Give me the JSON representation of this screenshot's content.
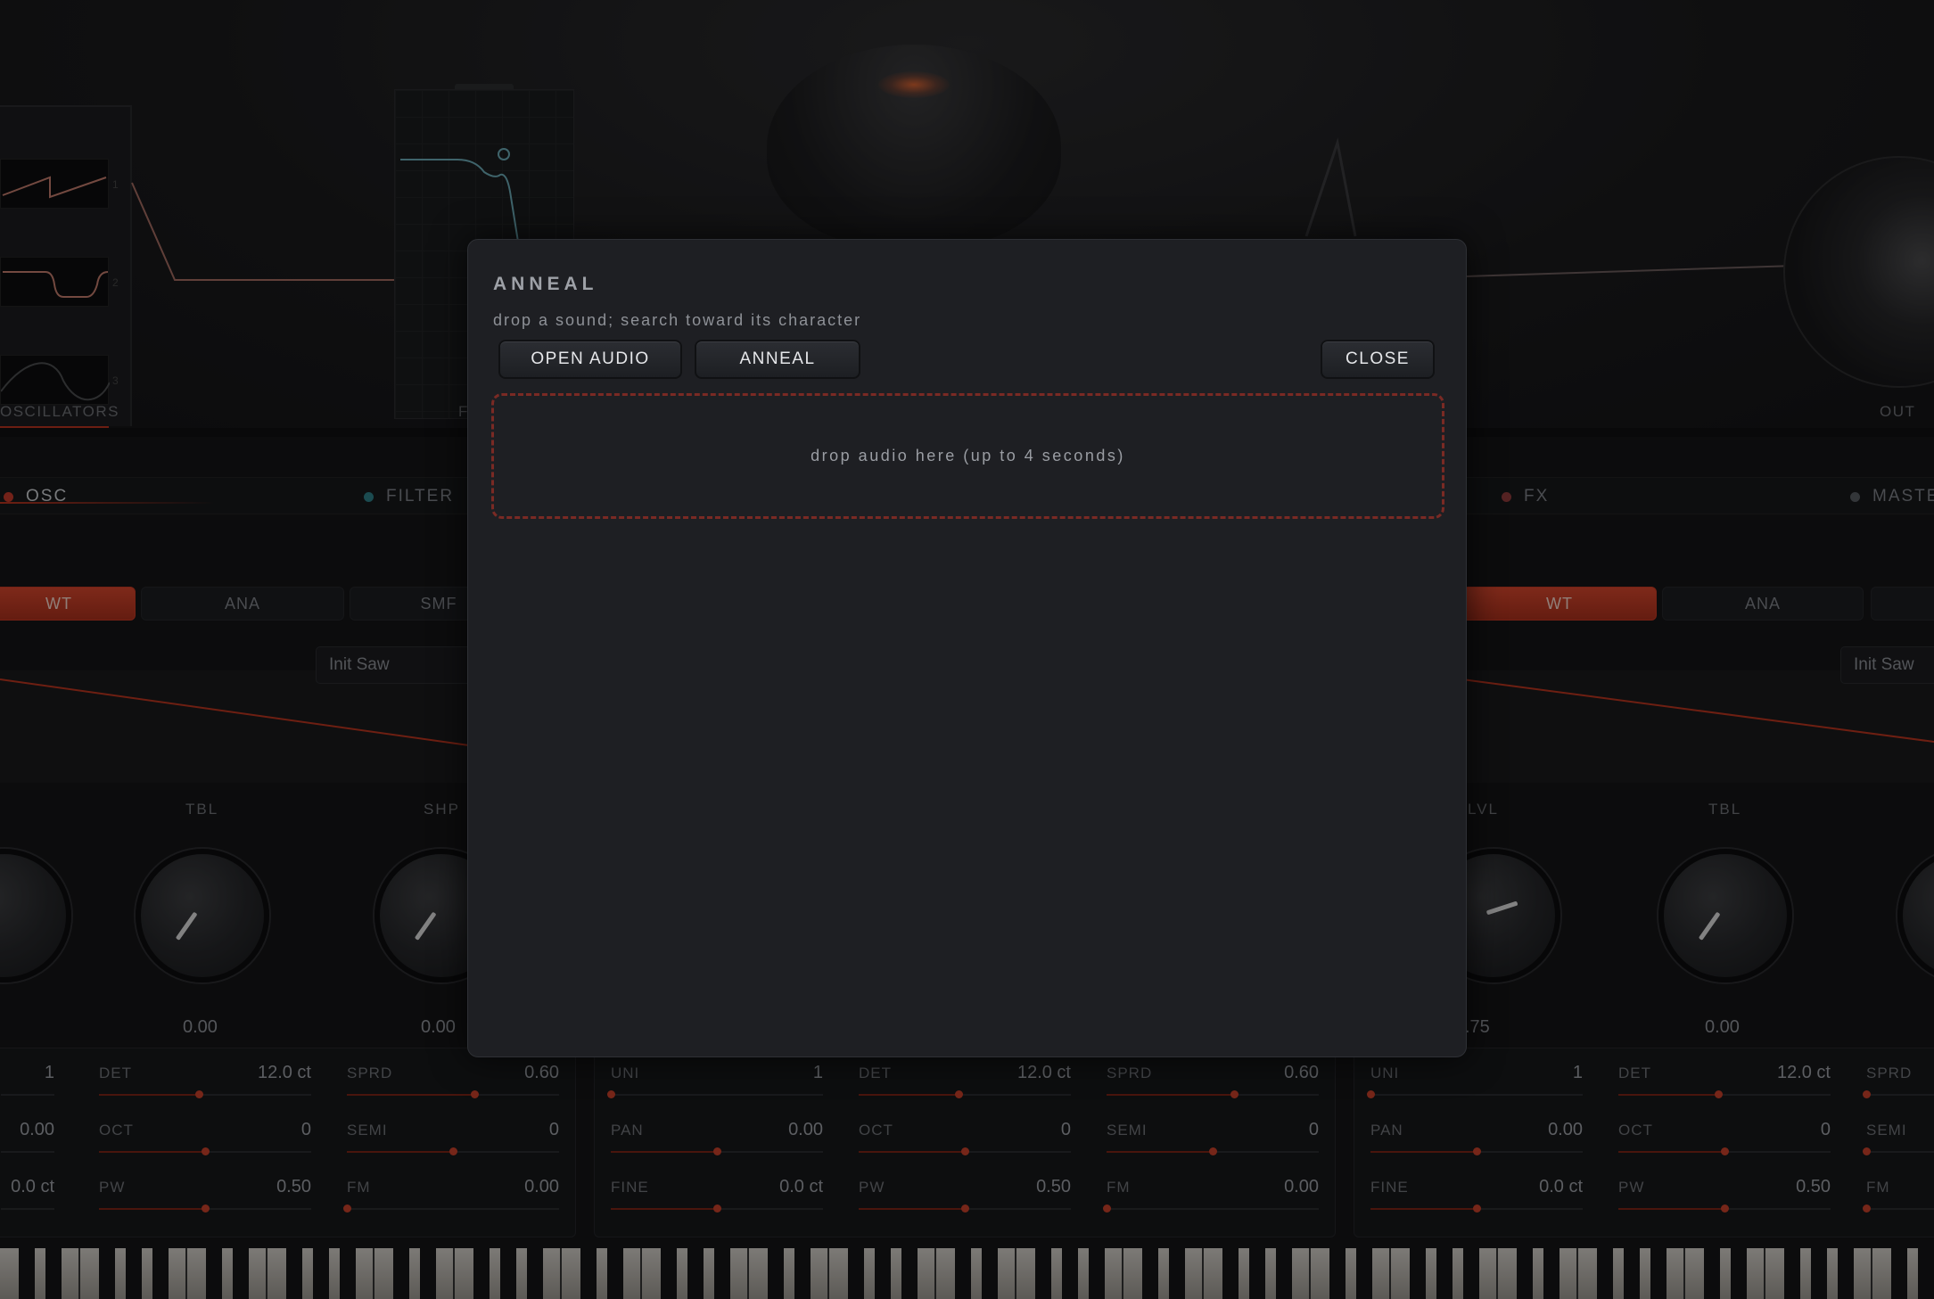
{
  "background": {
    "section_labels": {
      "oscillators": "OSCILLATORS",
      "filter_cut": "F",
      "out": "OUT"
    },
    "osc_thumb_numbers": [
      "1",
      "2",
      "3"
    ],
    "tabs": [
      {
        "label": "OSC",
        "dot_color": "#c0392b"
      },
      {
        "label": "FILTER",
        "dot_color": "#2e7d86"
      },
      {
        "label": "FX",
        "dot_color": "#8e3b3b"
      },
      {
        "label": "MASTE",
        "dot_color": "#555a60"
      }
    ],
    "mode_buttons": {
      "left": [
        "WT",
        "ANA",
        "SMF"
      ],
      "right": [
        "WT",
        "ANA"
      ]
    },
    "presets": {
      "left": "Init Saw",
      "right": "Init Saw"
    },
    "knobs": [
      {
        "label": "TBL",
        "value": "0.00"
      },
      {
        "label": "SHP",
        "value": "0.00"
      },
      {
        "label": "LVL",
        "value": ".75"
      },
      {
        "label": "TBL",
        "value": "0.00"
      }
    ],
    "strip_left_partial": [
      {
        "label": "",
        "value": "1"
      },
      {
        "label": "",
        "value": "0.00"
      },
      {
        "label": "",
        "value": "0.0 ct"
      }
    ],
    "strip_params": [
      [
        {
          "label": "DET",
          "value": "12.0 ct",
          "fill": 0.47
        },
        {
          "label": "SPRD",
          "value": "0.60",
          "fill": 0.6
        },
        {
          "label": "OCT",
          "value": "0",
          "fill": 0.5
        },
        {
          "label": "SEMI",
          "value": "0",
          "fill": 0.5
        },
        {
          "label": "PW",
          "value": "0.50",
          "fill": 0.5
        },
        {
          "label": "FM",
          "value": "0.00",
          "fill": 0.0
        }
      ],
      [
        {
          "label": "UNI",
          "value": "1",
          "fill": 0.0
        },
        {
          "label": "DET",
          "value": "12.0 ct",
          "fill": 0.47
        },
        {
          "label": "SPRD",
          "value": "0.60",
          "fill": 0.6
        },
        {
          "label": "PAN",
          "value": "0.00",
          "fill": 0.5
        },
        {
          "label": "OCT",
          "value": "0",
          "fill": 0.5
        },
        {
          "label": "SEMI",
          "value": "0",
          "fill": 0.5
        },
        {
          "label": "FINE",
          "value": "0.0 ct",
          "fill": 0.5
        },
        {
          "label": "PW",
          "value": "0.50",
          "fill": 0.5
        },
        {
          "label": "FM",
          "value": "0.00",
          "fill": 0.0
        }
      ],
      [
        {
          "label": "UNI",
          "value": "1",
          "fill": 0.0
        },
        {
          "label": "DET",
          "value": "12.0 ct",
          "fill": 0.47
        },
        {
          "label": "SPRD",
          "value": "",
          "fill": 0.0
        },
        {
          "label": "PAN",
          "value": "0.00",
          "fill": 0.5
        },
        {
          "label": "OCT",
          "value": "0",
          "fill": 0.5
        },
        {
          "label": "SEMI",
          "value": "",
          "fill": 0.0
        },
        {
          "label": "FINE",
          "value": "0.0 ct",
          "fill": 0.5
        },
        {
          "label": "PW",
          "value": "0.50",
          "fill": 0.5
        },
        {
          "label": "FM",
          "value": "",
          "fill": 0.0
        }
      ]
    ]
  },
  "modal": {
    "title": "ANNEAL",
    "subtitle": "drop a sound; search toward its character",
    "buttons": {
      "open_audio": "OPEN AUDIO",
      "anneal": "ANNEAL",
      "close": "CLOSE"
    },
    "dropzone_text": "drop audio here (up to 4 seconds)"
  },
  "colors": {
    "accent": "#c5402a",
    "dropzone_border": "#7a2a24",
    "modal_bg": "#1e1f23"
  }
}
